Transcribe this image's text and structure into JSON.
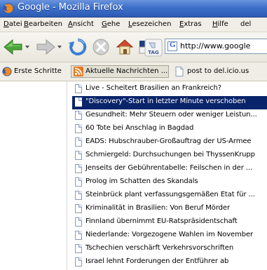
{
  "window": {
    "title": "Google - Mozilla Firefox"
  },
  "menubar": {
    "items": [
      {
        "accel": "D",
        "rest": "atei"
      },
      {
        "accel": "B",
        "rest": "earbeiten"
      },
      {
        "accel": "A",
        "rest": "nsicht"
      },
      {
        "accel": "G",
        "rest": "ehe"
      },
      {
        "accel": "L",
        "rest": "esezeichen"
      },
      {
        "accel": "E",
        "rest": "xtras"
      },
      {
        "accel": "H",
        "rest": "ilfe"
      },
      {
        "accel": "",
        "rest": "del"
      }
    ]
  },
  "navbar": {
    "url": "http://www.google",
    "url_icon": "G",
    "buttons": [
      "back-icon",
      "forward-icon",
      "reload-icon",
      "stop-icon",
      "home-icon",
      "bookmark-this-icon",
      "tag-icon"
    ],
    "tag_label": "TAG"
  },
  "bookmarks": {
    "items": [
      {
        "label": "Erste Schritte",
        "icon": "firefox-icon"
      },
      {
        "label": "Aktuelle Nachrichten ...",
        "icon": "rss-feed-icon"
      },
      {
        "label": "post to del.icio.us",
        "icon": "page-icon"
      }
    ]
  },
  "feed": {
    "items": [
      "Live - Scheitert Brasilien an Frankreich?",
      "\"Discovery\"-Start in letzter Minute verschoben",
      "Gesundheit: Mehr Steuern oder weniger Leistun...",
      "60 Tote bei Anschlag in Bagdad",
      "EADS: Hubschrauber-Großauftrag der US-Armee",
      "Schmiergeld: Durchsuchungen bei ThyssenKrupp",
      "Jenseits der Gebührentabelle: Feilschen in der ...",
      "Prolog im Schatten des Skandals",
      "Steinbrück plant verfassungsgemäßen Etat für ...",
      "Kriminalität in Brasilien: Von Beruf Mörder",
      "Finnland übernimmt EU-Ratspräsidentschaft",
      "Niederlande: Vorgezogene Wahlen im November",
      "Tschechien verschärft Verkehrsvorschriften",
      "Israel lehnt Forderungen der Entführer ab"
    ],
    "selected_index": 1
  },
  "colors": {
    "titlebar": "#3d6fca",
    "selection": "#0a246a",
    "rss": "#e8791f"
  }
}
